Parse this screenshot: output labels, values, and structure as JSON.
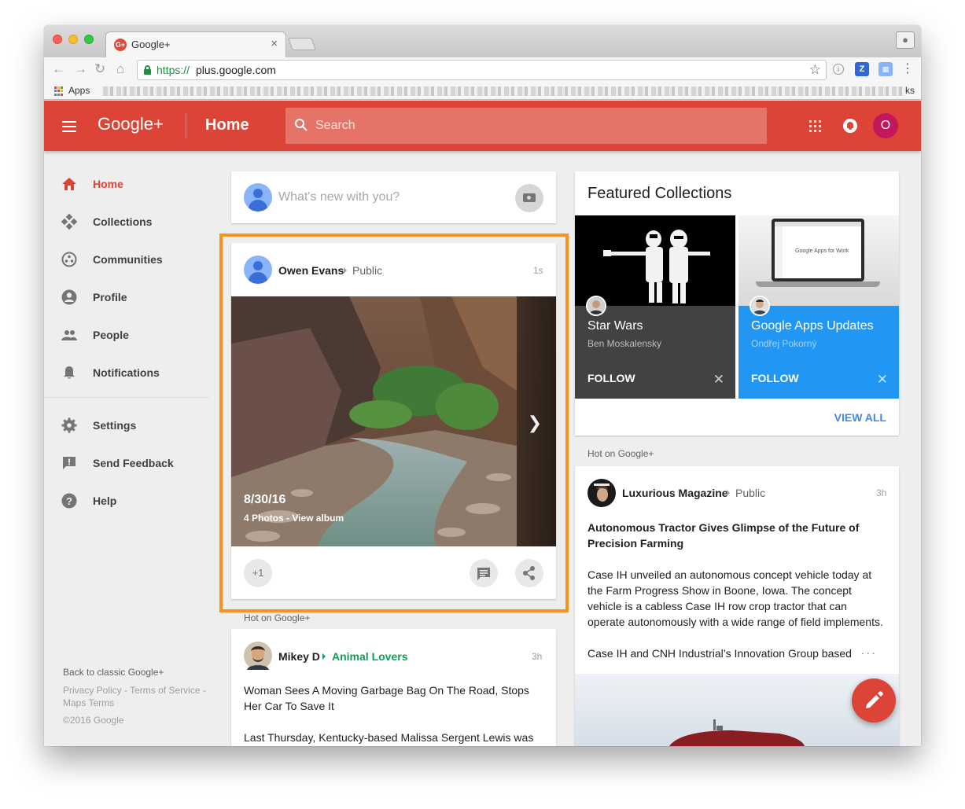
{
  "browser": {
    "tab_title": "Google+",
    "url_scheme": "https://",
    "url_host": "plus.google.com",
    "bookmarks_apps": "Apps",
    "bookmarks_tail": "ks",
    "extensions": [
      "i",
      "Z",
      "..."
    ]
  },
  "header": {
    "logo": "Google+",
    "page_title": "Home",
    "search_placeholder": "Search",
    "avatar_letter": "O",
    "accent": "#db4437"
  },
  "sidebar": {
    "items": [
      {
        "label": "Home",
        "icon": "home-icon",
        "active": true
      },
      {
        "label": "Collections",
        "icon": "collections-icon"
      },
      {
        "label": "Communities",
        "icon": "communities-icon"
      },
      {
        "label": "Profile",
        "icon": "profile-icon"
      },
      {
        "label": "People",
        "icon": "people-icon"
      },
      {
        "label": "Notifications",
        "icon": "notifications-bell-icon"
      },
      {
        "label": "Settings",
        "icon": "gear-icon"
      },
      {
        "label": "Send Feedback",
        "icon": "feedback-icon"
      },
      {
        "label": "Help",
        "icon": "help-icon"
      }
    ],
    "footer": {
      "classic": "Back to classic Google+",
      "links": "Privacy Policy - Terms of Service - Maps Terms",
      "copyright": "©2016 Google"
    }
  },
  "compose": {
    "placeholder": "What's new with you?"
  },
  "posts": [
    {
      "author": "Owen Evans",
      "visibility": "Public",
      "time": "1s",
      "album_date": "8/30/16",
      "album_sub": "4 Photos - View album",
      "plus_one": "+1"
    },
    {
      "section": "Hot on Google+",
      "author": "Mikey D",
      "community": "Animal Lovers",
      "time": "3h",
      "title": "Woman Sees A Moving Garbage Bag On The Road, Stops Her Car To Save It",
      "body": "Last Thursday, Kentucky-based Malissa Sergent Lewis was"
    }
  ],
  "featured": {
    "title": "Featured Collections",
    "view_all": "VIEW ALL",
    "collections": [
      {
        "name": "Star Wars",
        "owner": "Ben Moskalensky",
        "follow": "FOLLOW",
        "color": "#424242"
      },
      {
        "name": "Google Apps Updates",
        "owner": "Ondřej Pokorný",
        "follow": "FOLLOW",
        "color": "#2196f3",
        "image_text": "Google Apps for Work"
      }
    ]
  },
  "right_post": {
    "section": "Hot on Google+",
    "author": "Luxurious Magazine",
    "visibility": "Public",
    "time": "3h",
    "title": "Autonomous Tractor Gives Glimpse of the Future of Precision Farming",
    "body": "Case IH unveiled an autonomous concept vehicle today at the Farm Progress Show in Boone, Iowa. The concept vehicle is a cabless Case IH row crop tractor that can operate autonomously with a wide range of field implements.",
    "body2": "Case IH and CNH Industrial’s Innovation Group based th",
    "more": "..."
  }
}
